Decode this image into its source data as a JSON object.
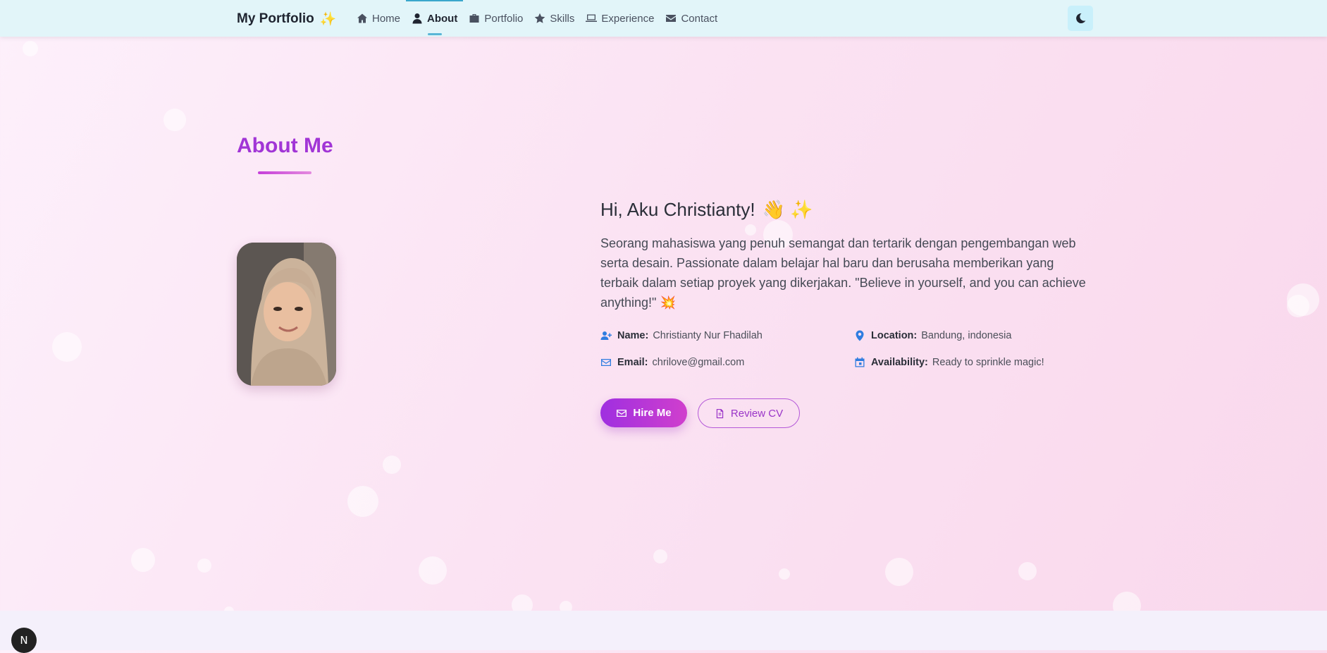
{
  "navbar": {
    "brand": "My Portfolio",
    "brand_emoji": "✨",
    "items": [
      {
        "label": "Home",
        "icon": "home-icon"
      },
      {
        "label": "About",
        "icon": "user-icon",
        "active": true
      },
      {
        "label": "Portfolio",
        "icon": "briefcase-icon"
      },
      {
        "label": "Skills",
        "icon": "star-icon"
      },
      {
        "label": "Experience",
        "icon": "laptop-icon"
      },
      {
        "label": "Contact",
        "icon": "envelope-icon"
      }
    ],
    "theme_toggle_icon": "moon-icon"
  },
  "about": {
    "title": "About Me",
    "greeting": "Hi, Aku Christianty!",
    "greeting_emojis": "👋 ✨",
    "bio": "Seorang mahasiswa yang penuh semangat dan tertarik dengan pengembangan web serta desain. Passionate dalam belajar hal baru dan berusaha memberikan yang terbaik dalam setiap proyek yang dikerjakan. \"Believe in yourself, and you can achieve anything!\" 💥",
    "info": {
      "name_label": "Name:",
      "name_value": "Christianty Nur Fhadilah",
      "location_label": "Location:",
      "location_value": "Bandung, indonesia",
      "email_label": "Email:",
      "email_value": "chrilove@gmail.com",
      "availability_label": "Availability:",
      "availability_value": "Ready to sprinkle magic!"
    },
    "buttons": {
      "hire": "Hire Me",
      "cv": "Review CV"
    }
  },
  "dev_badge": "N",
  "colors": {
    "accent": "#a135d6",
    "navbar_bg": "#e2f5f9",
    "info_icon": "#2f7de0"
  }
}
